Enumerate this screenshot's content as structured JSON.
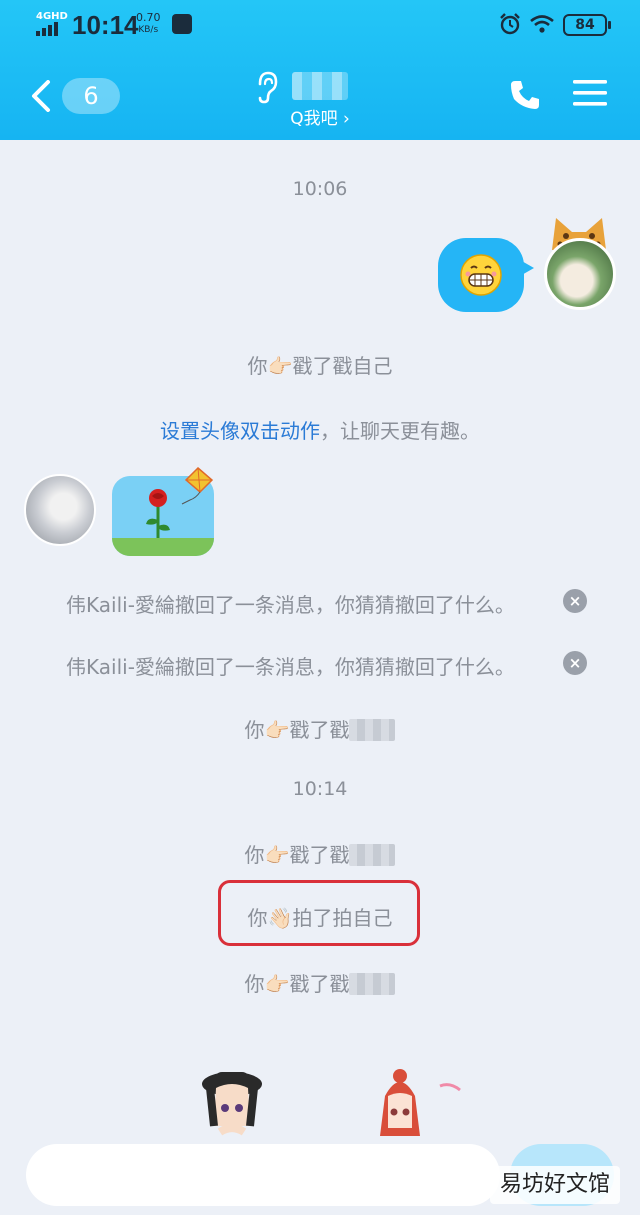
{
  "status_bar": {
    "network": "4GHD",
    "time": "10:14",
    "speed_value": "0.70",
    "speed_unit": "KB/s",
    "battery": "84"
  },
  "header": {
    "back_count": "6",
    "subtitle": "Q我吧 ›",
    "icons": [
      "back-chevron-icon",
      "ear-icon",
      "phone-icon",
      "menu-icon"
    ]
  },
  "messages": {
    "time_1": "10:06",
    "poke_self_1": {
      "prefix": "你",
      "hand": "👉🏻",
      "suffix": "戳了戳自己"
    },
    "hint_link": "设置头像双击动作",
    "hint_text": "，让聊天更有趣。",
    "recall_1": "伟Kaili-愛綸撤回了一条消息，你猜猜撤回了什么。",
    "recall_2": "伟Kaili-愛綸撤回了一条消息，你猜猜撤回了什么。",
    "poke_other_1": {
      "prefix": "你",
      "hand": "👉🏻",
      "suffix": "戳了戳"
    },
    "time_2": "10:14",
    "poke_other_2": {
      "prefix": "你",
      "hand": "👉🏻",
      "suffix": "戳了戳"
    },
    "pat_self": {
      "prefix": "你",
      "hand": "👋🏻",
      "suffix": "拍了拍自己"
    },
    "poke_other_3": {
      "prefix": "你",
      "hand": "👉🏻",
      "suffix": "戳了戳"
    }
  },
  "watermark": "易坊好文馆",
  "colors": {
    "header_top": "#24c6f7",
    "bubble_blue": "#25b5f6",
    "link_blue": "#2b7bd6",
    "highlight_red": "#d9303a",
    "system_text": "#8b9099"
  }
}
